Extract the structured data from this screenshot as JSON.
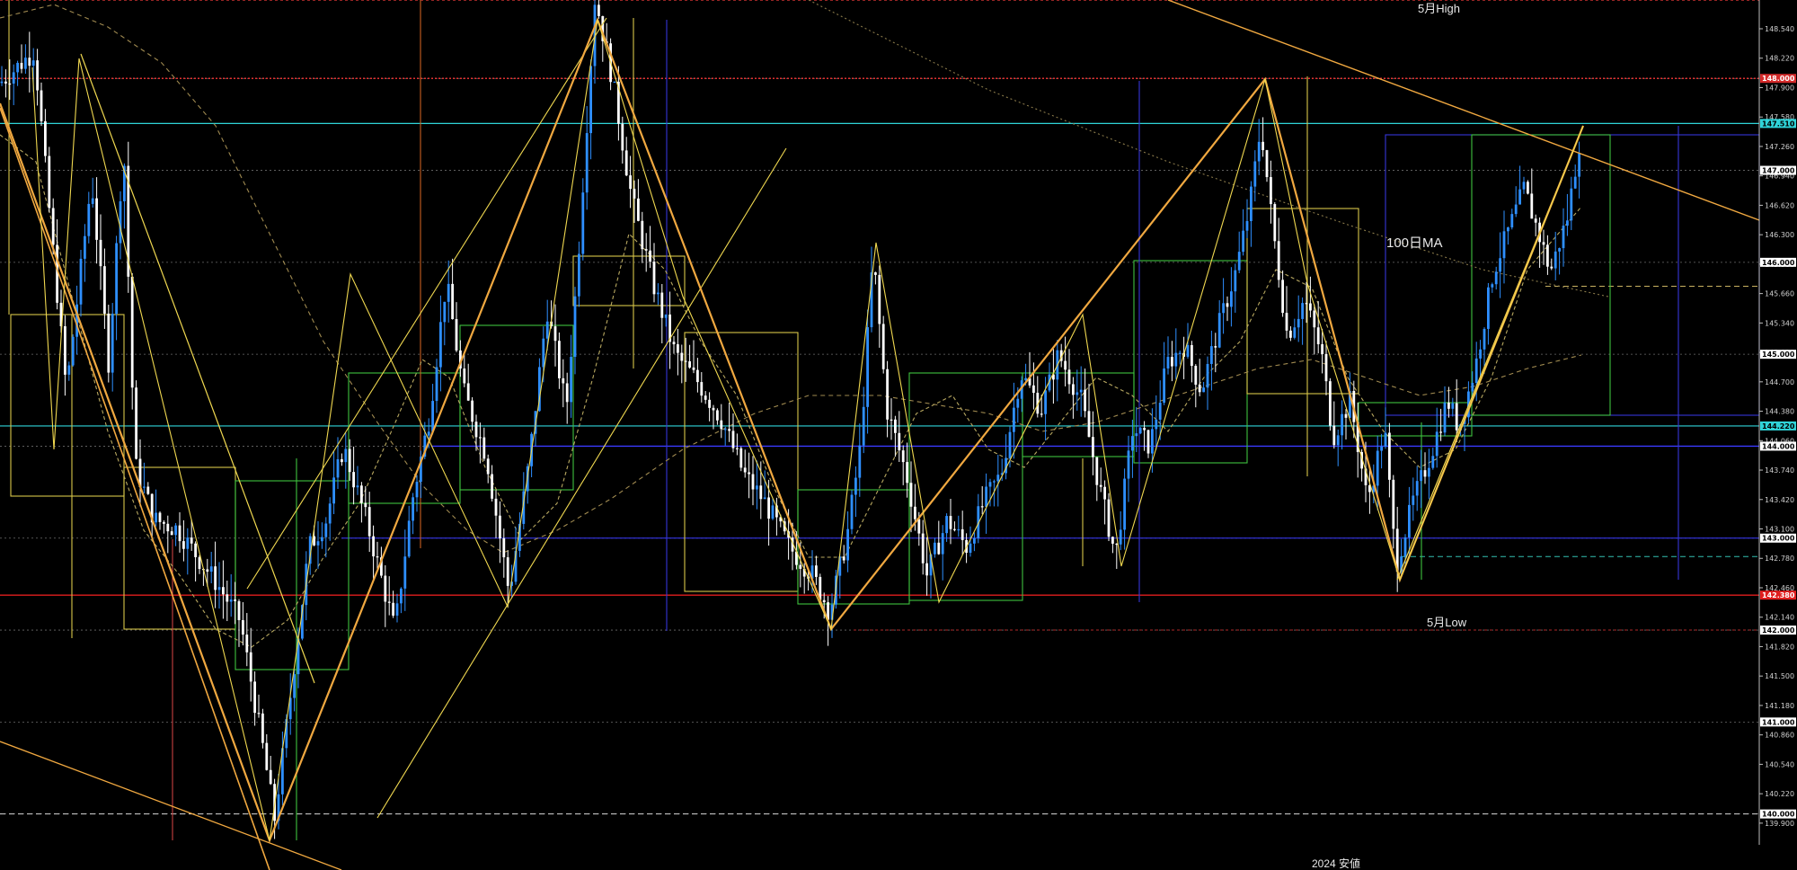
{
  "chart_data": {
    "type": "candlestick",
    "title": "",
    "ylim": [
      139.78,
      149.12
    ],
    "y_ticks": [
      148.54,
      148.22,
      147.9,
      147.58,
      147.26,
      146.94,
      146.62,
      146.3,
      145.98,
      145.66,
      145.34,
      145.02,
      144.7,
      144.38,
      144.06,
      143.74,
      143.42,
      143.1,
      142.78,
      142.46,
      142.14,
      141.82,
      141.5,
      141.18,
      140.86,
      140.54,
      140.22,
      139.9
    ],
    "price_tags": [
      {
        "value": 148.0,
        "label": "148.000",
        "bg": "#d42a2a",
        "fg": "#ffffff"
      },
      {
        "value": 147.51,
        "label": "147.510",
        "bg": "#2fd3d8",
        "fg": "#000000"
      },
      {
        "value": 147.0,
        "label": "147.000",
        "bg": "#ffffff",
        "fg": "#000000"
      },
      {
        "value": 146.0,
        "label": "146.000",
        "bg": "#ffffff",
        "fg": "#000000"
      },
      {
        "value": 145.0,
        "label": "145.000",
        "bg": "#ffffff",
        "fg": "#000000"
      },
      {
        "value": 144.22,
        "label": "144.220",
        "bg": "#2fd3d8",
        "fg": "#000000"
      },
      {
        "value": 144.0,
        "label": "144.000",
        "bg": "#ffffff",
        "fg": "#000000"
      },
      {
        "value": 143.0,
        "label": "143.000",
        "bg": "#ffffff",
        "fg": "#000000"
      },
      {
        "value": 142.38,
        "label": "142.380",
        "bg": "#e01e1e",
        "fg": "#ffffff"
      },
      {
        "value": 142.0,
        "label": "142.000",
        "bg": "#ffffff",
        "fg": "#000000"
      },
      {
        "value": 141.0,
        "label": "141.000",
        "bg": "#ffffff",
        "fg": "#000000"
      },
      {
        "value": 140.0,
        "label": "140.000",
        "bg": "#ffffff",
        "fg": "#000000"
      }
    ],
    "annotations": {
      "may_high": "5月High",
      "may_low": "5月Low",
      "ma100": "100日MA",
      "footer": "2024 安値"
    },
    "swing_path": [
      [
        0,
        147.95
      ],
      [
        30,
        148.3
      ],
      [
        58,
        144.6
      ],
      [
        80,
        146.9
      ],
      [
        95,
        144.9
      ],
      [
        108,
        147.3
      ],
      [
        118,
        143.8
      ],
      [
        135,
        143.2
      ],
      [
        155,
        143.1
      ],
      [
        190,
        142.5
      ],
      [
        210,
        142.1
      ],
      [
        230,
        140.7
      ],
      [
        240,
        139.95
      ],
      [
        255,
        141.4
      ],
      [
        270,
        142.9
      ],
      [
        285,
        143.2
      ],
      [
        300,
        144.0
      ],
      [
        320,
        143.2
      ],
      [
        345,
        142.0
      ],
      [
        360,
        143.4
      ],
      [
        375,
        144.3
      ],
      [
        390,
        145.8
      ],
      [
        405,
        144.6
      ],
      [
        425,
        143.9
      ],
      [
        445,
        142.4
      ],
      [
        462,
        143.8
      ],
      [
        478,
        145.5
      ],
      [
        495,
        144.4
      ],
      [
        505,
        146.0
      ],
      [
        520,
        148.9
      ],
      [
        535,
        148.0
      ],
      [
        552,
        146.7
      ],
      [
        570,
        145.8
      ],
      [
        590,
        145.0
      ],
      [
        610,
        144.7
      ],
      [
        630,
        144.3
      ],
      [
        650,
        143.7
      ],
      [
        668,
        143.4
      ],
      [
        690,
        142.9
      ],
      [
        710,
        142.6
      ],
      [
        725,
        142.2
      ],
      [
        740,
        143.0
      ],
      [
        752,
        144.0
      ],
      [
        763,
        146.1
      ],
      [
        775,
        144.4
      ],
      [
        792,
        143.7
      ],
      [
        810,
        142.6
      ],
      [
        828,
        143.2
      ],
      [
        845,
        142.9
      ],
      [
        860,
        143.4
      ],
      [
        875,
        143.7
      ],
      [
        892,
        144.8
      ],
      [
        910,
        144.4
      ],
      [
        925,
        145.0
      ],
      [
        945,
        144.5
      ],
      [
        960,
        143.6
      ],
      [
        975,
        142.8
      ],
      [
        990,
        144.2
      ],
      [
        1005,
        144.0
      ],
      [
        1020,
        144.9
      ],
      [
        1035,
        145.1
      ],
      [
        1050,
        144.6
      ],
      [
        1065,
        145.3
      ],
      [
        1080,
        145.9
      ],
      [
        1092,
        146.6
      ],
      [
        1102,
        147.5
      ],
      [
        1112,
        146.4
      ],
      [
        1125,
        145.2
      ],
      [
        1140,
        145.6
      ],
      [
        1155,
        145.0
      ],
      [
        1165,
        144.1
      ],
      [
        1180,
        144.5
      ],
      [
        1195,
        143.4
      ],
      [
        1210,
        144.2
      ],
      [
        1220,
        142.7
      ],
      [
        1235,
        143.4
      ],
      [
        1250,
        143.9
      ],
      [
        1265,
        144.5
      ],
      [
        1275,
        144.2
      ],
      [
        1290,
        144.9
      ],
      [
        1305,
        145.9
      ],
      [
        1320,
        146.4
      ],
      [
        1332,
        146.8
      ],
      [
        1345,
        146.3
      ],
      [
        1355,
        145.9
      ],
      [
        1370,
        146.5
      ],
      [
        1382,
        147.45
      ]
    ]
  }
}
